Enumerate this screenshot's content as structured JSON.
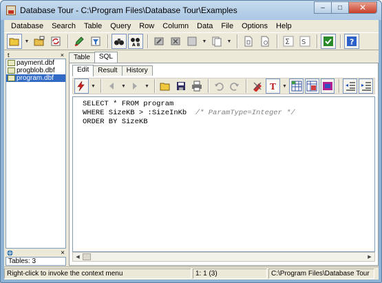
{
  "window": {
    "title": "Database Tour - C:\\Program Files\\Database Tour\\Examples",
    "minimize_glyph": "–",
    "maximize_glyph": "□",
    "close_glyph": "✕"
  },
  "menubar": {
    "items": [
      "Database",
      "Search",
      "Table",
      "Query",
      "Row",
      "Column",
      "Data",
      "File",
      "Options",
      "Help"
    ]
  },
  "left_panel": {
    "top_indicator": "t",
    "close_glyph": "×",
    "files": [
      {
        "name": "payment.dbf",
        "selected": false
      },
      {
        "name": "progblob.dbf",
        "selected": false
      },
      {
        "name": "program.dbf",
        "selected": true
      }
    ],
    "bottom_close_glyph": "×",
    "tables_count": "Tables: 3"
  },
  "tabs": {
    "main": [
      {
        "label": "Table",
        "active": false
      },
      {
        "label": "SQL",
        "active": true
      }
    ],
    "sub": [
      {
        "label": "Edit",
        "active": true
      },
      {
        "label": "Result",
        "active": false
      },
      {
        "label": "History",
        "active": false
      }
    ]
  },
  "editor": {
    "lines": [
      "SELECT * FROM program",
      "WHERE SizeKB > :SizeInKb  ",
      "ORDER BY SizeKB"
    ],
    "comment": "/* ParamType=Integer */"
  },
  "statusbar": {
    "hint": "Right-click to invoke the context menu",
    "position": "1:  1  (3)",
    "path": "C:\\Program Files\\Database Tour"
  },
  "colors": {
    "selection": "#316ac5",
    "client_bg": "#ece9d8",
    "title_bg": "#a9c6e3"
  }
}
